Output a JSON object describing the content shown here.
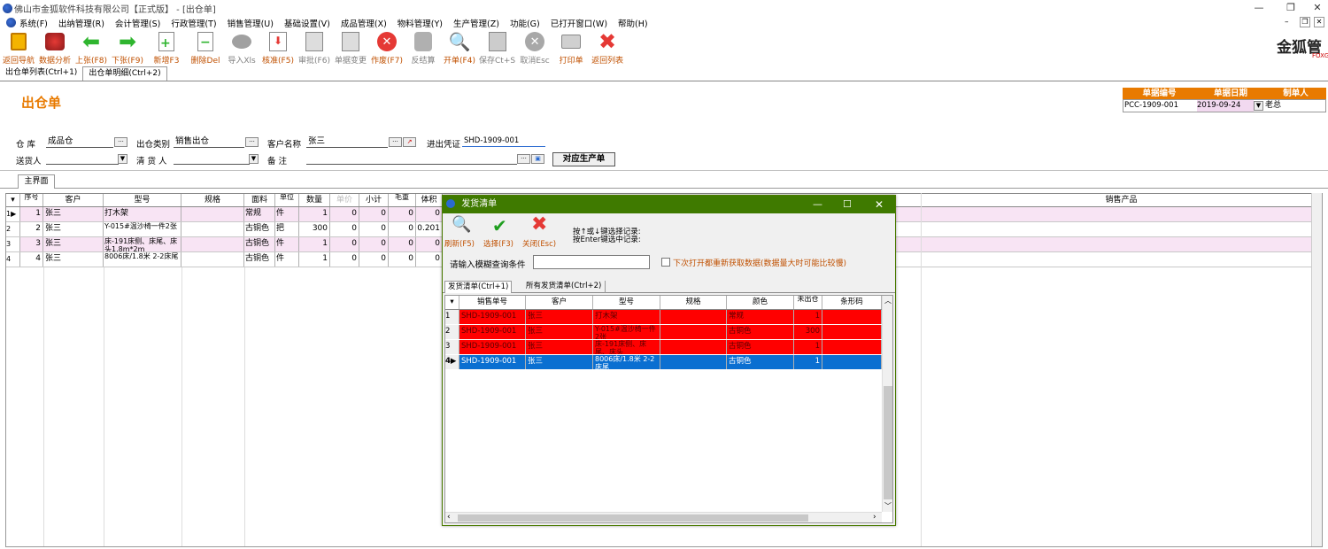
{
  "window": {
    "title": "佛山市金狐软件科技有限公司【正式版】 - [出仓单]",
    "min": "—",
    "restore": "❐",
    "close": "✕"
  },
  "menu": [
    "系统(F)",
    "出纳管理(R)",
    "会计管理(S)",
    "行政管理(T)",
    "销售管理(U)",
    "基础设置(V)",
    "成品管理(X)",
    "物料管理(Y)",
    "生产管理(Z)",
    "功能(G)",
    "已打开窗口(W)",
    "帮助(H)"
  ],
  "toolbar": [
    {
      "label": "返回导航",
      "icon": "back-nav-icon"
    },
    {
      "label": "数据分析",
      "icon": "data-analysis-icon"
    },
    {
      "label": "上张(F8)",
      "icon": "prev-arrow-icon"
    },
    {
      "label": "下张(F9)",
      "icon": "next-arrow-icon"
    },
    {
      "label": "新增F3",
      "icon": "new-doc-icon"
    },
    {
      "label": "删除Del",
      "icon": "delete-doc-icon"
    },
    {
      "label": "导入Xls",
      "icon": "import-icon"
    },
    {
      "label": "核准(F5)",
      "icon": "approve-icon"
    },
    {
      "label": "审批(F6)",
      "icon": "review-icon"
    },
    {
      "label": "单据变更",
      "icon": "change-icon"
    },
    {
      "label": "作废(F7)",
      "icon": "void-icon"
    },
    {
      "label": "反结算",
      "icon": "unsettle-icon"
    },
    {
      "label": "开单(F4)",
      "icon": "open-order-icon"
    },
    {
      "label": "保存Ct+S",
      "icon": "save-icon"
    },
    {
      "label": "取消Esc",
      "icon": "cancel-icon"
    },
    {
      "label": "打印单",
      "icon": "print-icon"
    },
    {
      "label": "返回列表",
      "icon": "return-list-icon"
    }
  ],
  "logo": {
    "text": "金狐管",
    "sub": "FOXG"
  },
  "doctabs": [
    "出仓单列表(Ctrl+1)",
    "出仓单明细(Ctrl+2)"
  ],
  "form": {
    "heading": "出仓单",
    "info_headers": [
      "单据编号",
      "单据日期",
      "制单人"
    ],
    "info_values": [
      "PCC-1909-001",
      "2019-09-24",
      "老总"
    ],
    "warehouse_label": "仓 库",
    "warehouse": "成品仓",
    "outtype_label": "出仓类别",
    "outtype": "销售出仓",
    "customer_label": "客户名称",
    "customer": "张三",
    "voucher_label": "进出凭证",
    "voucher": "SHD-1909-001",
    "deliverer_label": "送货人",
    "deliverer": "",
    "cleaner_label": "清 货 人",
    "cleaner": "",
    "remark_label": "备   注",
    "remark": "",
    "match_button": "对应生产单"
  },
  "subtab": "主界面",
  "grid": {
    "headers": [
      "序号",
      "客户",
      "型号",
      "规格",
      "面料",
      "单位",
      "数量",
      "单价",
      "小计",
      "毛重",
      "体积",
      "销售产品"
    ],
    "rows": [
      {
        "no": "1",
        "customer": "张三",
        "model": "打木架",
        "spec": "",
        "fabric": "常规",
        "unit": "件",
        "qty": "1",
        "price": "0",
        "sub": "0",
        "wt": "0",
        "vol": "0"
      },
      {
        "no": "2",
        "customer": "张三",
        "model": "Y-015#温沙椅一件2张",
        "spec": "",
        "fabric": "古铜色",
        "unit": "把",
        "qty": "300",
        "price": "0",
        "sub": "0",
        "wt": "0",
        "vol": "0.201"
      },
      {
        "no": "3",
        "customer": "张三",
        "model": "床-191床侧、床尾、床头1.8m*2m",
        "spec": "",
        "fabric": "古铜色",
        "unit": "件",
        "qty": "1",
        "price": "0",
        "sub": "0",
        "wt": "0",
        "vol": "0"
      },
      {
        "no": "4",
        "customer": "张三",
        "model": "8006床/1.8米 2-2床尾",
        "spec": "",
        "fabric": "古铜色",
        "unit": "件",
        "qty": "1",
        "price": "0",
        "sub": "0",
        "wt": "0",
        "vol": "0"
      }
    ]
  },
  "dialog": {
    "title": "发货清单",
    "buttons": [
      "刷新(F5)",
      "选择(F3)",
      "关闭(Esc)"
    ],
    "hint1": "按↑或↓键选择记录:",
    "hint2": "按Enter键选中记录:",
    "search_label": "请输入模糊查询条件",
    "search_value": "",
    "refresh_check": "下次打开都重新获取数据(数据量大时可能比较慢)",
    "tabs": [
      "发货清单(Ctrl+1)",
      "所有发货清单(Ctrl+2)"
    ],
    "headers": [
      "销售单号",
      "客户",
      "型号",
      "规格",
      "颜色",
      "未出仓",
      "条形码"
    ],
    "rows": [
      {
        "no": "1",
        "order": "SHD-1909-001",
        "customer": "张三",
        "model": "打木架",
        "spec": "",
        "color": "常规",
        "qty": "1",
        "barcode": ""
      },
      {
        "no": "2",
        "order": "SHD-1909-001",
        "customer": "张三",
        "model": "Y-015#温沙椅一件2张",
        "spec": "",
        "color": "古铜色",
        "qty": "300",
        "barcode": ""
      },
      {
        "no": "3",
        "order": "SHD-1909-001",
        "customer": "张三",
        "model": "床-191床侧、床尾、床头",
        "spec": "",
        "color": "古铜色",
        "qty": "1",
        "barcode": ""
      },
      {
        "no": "4",
        "order": "SHD-1909-001",
        "customer": "张三",
        "model": "8006床/1.8米 2-2床尾",
        "spec": "",
        "color": "古铜色",
        "qty": "1",
        "barcode": ""
      }
    ]
  },
  "colors": {
    "accent_orange": "#e87a00",
    "heading_orange": "#e87a00",
    "pink_row": "#f8e4f4",
    "red_row": "#ff0000",
    "blue_row": "#0a6fd1",
    "dialog_title": "#3f7a00"
  }
}
